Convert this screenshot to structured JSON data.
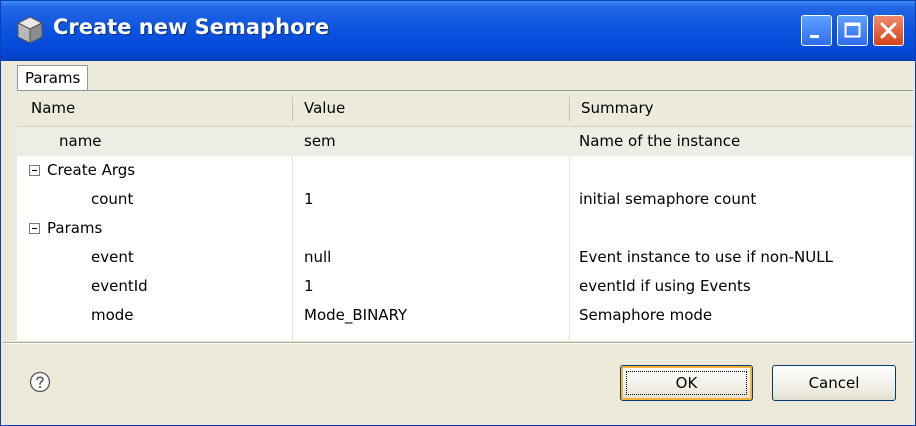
{
  "window": {
    "title": "Create new Semaphore"
  },
  "tabs": [
    {
      "label": "Params"
    }
  ],
  "table": {
    "headers": {
      "name": "Name",
      "value": "Value",
      "summary": "Summary"
    },
    "rows": [
      {
        "name": "name",
        "value": "sem",
        "summary": "Name of the instance"
      },
      {
        "group": "Create Args"
      },
      {
        "name": "count",
        "value": "1",
        "summary": "initial semaphore count"
      },
      {
        "group": "Params"
      },
      {
        "name": "event",
        "value": "null",
        "summary": "Event instance to use if non-NULL"
      },
      {
        "name": "eventId",
        "value": "1",
        "summary": "eventId if using Events"
      },
      {
        "name": "mode",
        "value": "Mode_BINARY",
        "summary": "Semaphore mode"
      }
    ]
  },
  "buttons": {
    "ok": "OK",
    "cancel": "Cancel"
  },
  "icons": {
    "app": "app-icon",
    "minimize": "minimize-icon",
    "maximize": "maximize-icon",
    "close": "close-icon",
    "help": "help-icon",
    "collapse": "collapse-icon"
  },
  "colors": {
    "titlebar": "#0a53e0",
    "close_button": "#d5431c",
    "header_bg": "#ebeadb",
    "dialog_bg": "#ece9d8"
  }
}
